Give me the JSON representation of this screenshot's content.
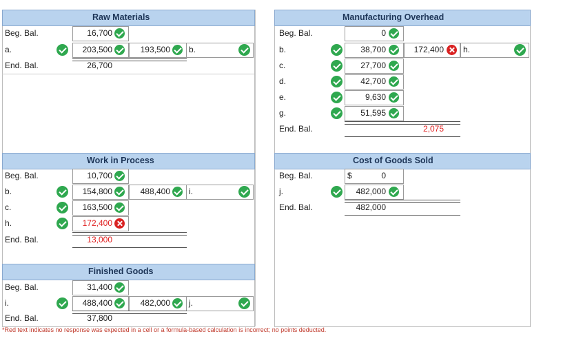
{
  "raw_materials": {
    "title": "Raw Materials",
    "beg_label": "Beg. Bal.",
    "beg_value": "16,700",
    "a_label": "a.",
    "a_value": "203,500",
    "credit_value": "193,500",
    "b_label": "b.",
    "end_label": "End. Bal.",
    "end_value": "26,700"
  },
  "overhead": {
    "title": "Manufacturing Overhead",
    "beg_label": "Beg. Bal.",
    "beg_value": "0",
    "rows": [
      {
        "label": "b.",
        "value": "38,700"
      },
      {
        "label": "c.",
        "value": "27,700"
      },
      {
        "label": "d.",
        "value": "42,700"
      },
      {
        "label": "e.",
        "value": "9,630"
      },
      {
        "label": "g.",
        "value": "51,595"
      }
    ],
    "credit_value": "172,400",
    "credit_label": "h.",
    "end_label": "End. Bal.",
    "end_value": "2,075"
  },
  "wip": {
    "title": "Work in Process",
    "beg_label": "Beg. Bal.",
    "beg_value": "10,700",
    "b_label": "b.",
    "b_value": "154,800",
    "credit_value": "488,400",
    "credit_label": "i.",
    "c_label": "c.",
    "c_value": "163,500",
    "h_label": "h.",
    "h_value": "172,400",
    "end_label": "End. Bal.",
    "end_value": "13,000"
  },
  "cogs": {
    "title": "Cost of Goods Sold",
    "beg_label": "Beg. Bal.",
    "currency": "$",
    "beg_value": "0",
    "j_label": "j.",
    "j_value": "482,000",
    "end_label": "End. Bal.",
    "end_value": "482,000"
  },
  "finished": {
    "title": "Finished Goods",
    "beg_label": "Beg. Bal.",
    "beg_value": "31,400",
    "i_label": "i.",
    "i_value": "488,400",
    "credit_value": "482,000",
    "credit_label": "j.",
    "end_label": "End. Bal.",
    "end_value": "37,800"
  },
  "footnote": "*Red text indicates no response was expected in a cell or a formula-based calculation is incorrect; no points deducted."
}
